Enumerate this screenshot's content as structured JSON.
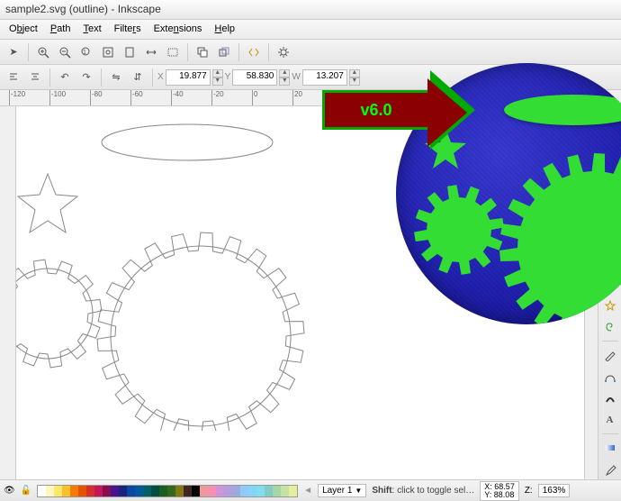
{
  "window": {
    "title": "sample2.svg (outline) - Inkscape"
  },
  "menu": {
    "items": [
      {
        "label": "Object",
        "accel": "O"
      },
      {
        "label": "Path",
        "accel": "P"
      },
      {
        "label": "Text",
        "accel": "T"
      },
      {
        "label": "Filters",
        "accel": "F"
      },
      {
        "label": "Extensions",
        "accel": "E"
      },
      {
        "label": "Help",
        "accel": "H"
      }
    ]
  },
  "toolbar1": {
    "icons": [
      "arrow",
      "zoom-in",
      "zoom-out",
      "zoom-fit",
      "zoom-page",
      "zoom-width",
      "zoom-drawing",
      "sep",
      "copy",
      "paste",
      "sep",
      "star-icon"
    ]
  },
  "toolbar2": {
    "lock": "🔒",
    "coords": {
      "x_label": "X",
      "x": "19.877",
      "y_label": "Y",
      "y": "58.830",
      "w_label": "W",
      "w": "13.207"
    }
  },
  "ruler": {
    "marks": [
      "-120",
      "-100",
      "-80",
      "-60",
      "-40",
      "-20",
      "0",
      "20"
    ]
  },
  "right_toolbar": {
    "icons": [
      "cursor",
      "edit-node",
      "sep",
      "bezier",
      "freehand",
      "calligraphy",
      "spray",
      "sep",
      "line",
      "rect",
      "ellipse",
      "star",
      "spiral",
      "sep",
      "text",
      "gradient",
      "dropper"
    ]
  },
  "arrow": {
    "label": "v6.0"
  },
  "status": {
    "eye": "👁",
    "lock": "🔓",
    "layer": "Layer 1",
    "hint_strong": "Shift",
    "hint": ": click to toggle sel…",
    "coord_x": "68.57",
    "coord_y": "88.08",
    "zoom_label": "Z:",
    "zoom": "163%"
  },
  "palette": [
    "#ffffff",
    "#fff7bf",
    "#fde76b",
    "#fbc02d",
    "#f57c00",
    "#e65100",
    "#d32f2f",
    "#c2185b",
    "#880e4f",
    "#4a148c",
    "#1a237e",
    "#0d47a1",
    "#01579b",
    "#006064",
    "#004d40",
    "#1b5e20",
    "#33691e",
    "#827717",
    "#3e2723",
    "#000000",
    "#ef9a9a",
    "#f48fb1",
    "#ce93d8",
    "#b39ddb",
    "#9fa8da",
    "#90caf9",
    "#81d4fa",
    "#80deea",
    "#80cbc4",
    "#a5d6a7",
    "#c5e1a5",
    "#e6ee9c"
  ]
}
